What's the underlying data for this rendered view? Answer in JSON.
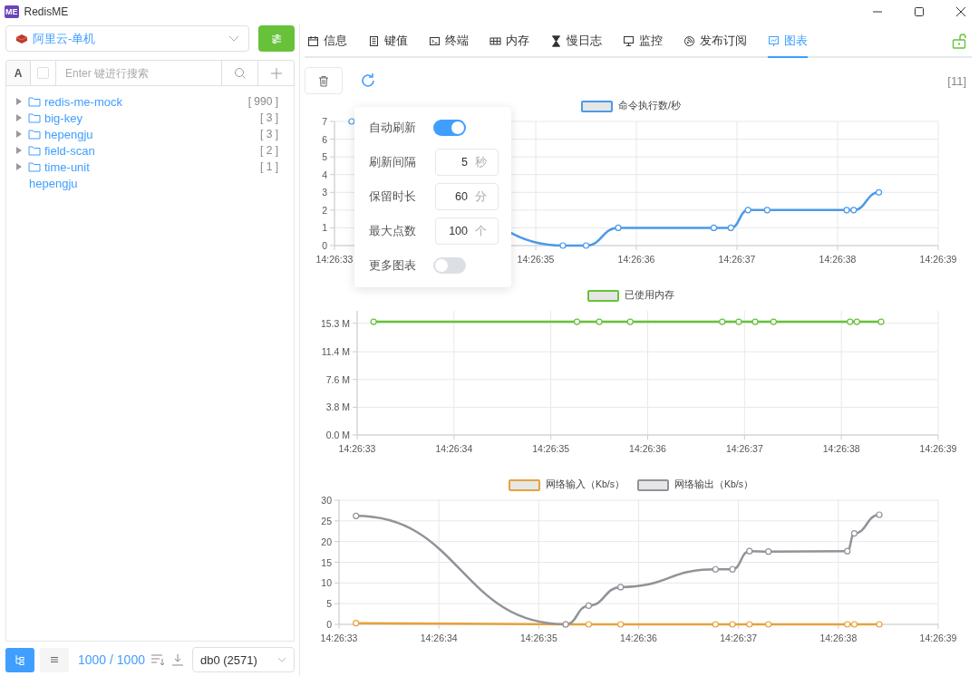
{
  "window": {
    "app_icon": "ME",
    "title": "RedisME"
  },
  "connection": {
    "value": "阿里云-单机"
  },
  "search": {
    "case_toggle": "A",
    "checked": false,
    "placeholder": "Enter 键进行搜索"
  },
  "tree": [
    {
      "kind": "folder",
      "name": "redis-me-mock",
      "count": "[ 990 ]",
      "expanded": false
    },
    {
      "kind": "folder",
      "name": "big-key",
      "count": "[ 3 ]",
      "expanded": false
    },
    {
      "kind": "folder",
      "name": "hepengju",
      "count": "[ 3 ]",
      "expanded": false
    },
    {
      "kind": "folder",
      "name": "field-scan",
      "count": "[ 2 ]",
      "expanded": false
    },
    {
      "kind": "folder",
      "name": "time-unit",
      "count": "[ 1 ]",
      "expanded": false
    },
    {
      "kind": "key",
      "name": "hepengju"
    }
  ],
  "footer": {
    "views": [
      {
        "selected": true
      },
      {
        "selected": false
      }
    ],
    "count": "1000 / 1000",
    "db": "db0 (2571)"
  },
  "tabs": [
    {
      "label": "信息",
      "selected": false
    },
    {
      "label": "键值",
      "selected": false
    },
    {
      "label": "终端",
      "selected": false
    },
    {
      "label": "内存",
      "selected": false
    },
    {
      "label": "慢日志",
      "selected": false
    },
    {
      "label": "监控",
      "selected": false
    },
    {
      "label": "发布订阅",
      "selected": false
    },
    {
      "label": "图表",
      "selected": true
    }
  ],
  "toolbar": {
    "count": "[11]"
  },
  "settings": [
    {
      "kind": "switch",
      "label": "自动刷新",
      "on": true
    },
    {
      "kind": "number",
      "label": "刷新间隔",
      "value": "5",
      "unit": "秒"
    },
    {
      "kind": "number",
      "label": "保留时长",
      "value": "60",
      "unit": "分"
    },
    {
      "kind": "number",
      "label": "最大点数",
      "value": "100",
      "unit": "个"
    },
    {
      "kind": "switch",
      "label": "更多图表",
      "on": false
    }
  ],
  "charts": [
    {
      "chart_data": {
        "type": "line",
        "x": [
          51993.17,
          51995.27,
          51995.5,
          51995.82,
          51996.77,
          51996.94,
          51997.11,
          51997.3,
          51998.09,
          51998.16,
          51998.41
        ],
        "series": [
          {
            "name": "命令执行数/秒",
            "color": "#4a9ae8",
            "marker": "circle",
            "values": [
              7,
              0,
              0,
              1,
              1,
              1,
              2,
              2,
              2,
              2,
              3
            ]
          }
        ],
        "xlim": [
          51993,
          51999
        ],
        "grid": true,
        "legend": "top",
        "ylim": [
          0,
          7
        ],
        "xticks": [
          {
            "value": 51993,
            "label": "14:26:33"
          },
          {
            "value": 51995,
            "label": "14:26:35"
          },
          {
            "value": 51996,
            "label": "14:26:36"
          },
          {
            "value": 51997,
            "label": "14:26:37"
          },
          {
            "value": 51998,
            "label": "14:26:38"
          },
          {
            "value": 51999,
            "label": "14:26:39"
          }
        ],
        "yticks": [
          0,
          1,
          2,
          3,
          4,
          5,
          6,
          7
        ]
      }
    },
    {
      "chart_data": {
        "type": "line",
        "x": [
          51993.17,
          51995.27,
          51995.5,
          51995.82,
          51996.77,
          51996.94,
          51997.11,
          51997.3,
          51998.09,
          51998.16,
          51998.41
        ],
        "series": [
          {
            "name": "已使用内存",
            "color": "#67c23a",
            "marker": "circle",
            "values": [
              15.5,
              15.5,
              15.5,
              15.5,
              15.5,
              15.5,
              15.5,
              15.5,
              15.5,
              15.5,
              15.5
            ]
          }
        ],
        "xlim": [
          51993,
          51999
        ],
        "grid": true,
        "legend": "top",
        "ylim": [
          0,
          17
        ],
        "xticks": [
          {
            "value": 51993,
            "label": "14:26:33"
          },
          {
            "value": 51994,
            "label": "14:26:34"
          },
          {
            "value": 51995,
            "label": "14:26:35"
          },
          {
            "value": 51996,
            "label": "14:26:36"
          },
          {
            "value": 51997,
            "label": "14:26:37"
          },
          {
            "value": 51998,
            "label": "14:26:38"
          },
          {
            "value": 51999,
            "label": "14:26:39"
          }
        ],
        "yticks": [
          {
            "value": 0,
            "label": "0.0 M"
          },
          {
            "value": 3.8,
            "label": "3.8 M"
          },
          {
            "value": 7.6,
            "label": "7.6 M"
          },
          {
            "value": 11.4,
            "label": "11.4 M"
          },
          {
            "value": 15.3,
            "label": "15.3 M"
          }
        ]
      }
    },
    {
      "chart_data": {
        "type": "line",
        "x": [
          51993.17,
          51995.27,
          51995.5,
          51995.82,
          51996.77,
          51996.94,
          51997.11,
          51997.3,
          51998.09,
          51998.16,
          51998.41
        ],
        "series": [
          {
            "name": "网络输入（Kb/s）",
            "color": "#e6a23c",
            "marker": "circle",
            "values": [
              0.3,
              0,
              0,
              0,
              0,
              0,
              0,
              0,
              0,
              0,
              0
            ]
          },
          {
            "name": "网络输出（Kb/s）",
            "color": "#909399",
            "marker": "circle",
            "values": [
              26.2,
              0,
              4.5,
              9,
              13.3,
              13.3,
              17.7,
              17.6,
              17.7,
              22,
              26.5
            ]
          }
        ],
        "xlim": [
          51993,
          51999
        ],
        "grid": true,
        "legend": "top",
        "ylim": [
          0,
          30
        ],
        "xticks": [
          {
            "value": 51993,
            "label": "14:26:33"
          },
          {
            "value": 51994,
            "label": "14:26:34"
          },
          {
            "value": 51995,
            "label": "14:26:35"
          },
          {
            "value": 51996,
            "label": "14:26:36"
          },
          {
            "value": 51997,
            "label": "14:26:37"
          },
          {
            "value": 51998,
            "label": "14:26:38"
          },
          {
            "value": 51999,
            "label": "14:26:39"
          }
        ],
        "yticks": [
          0,
          5,
          10,
          15,
          20,
          25,
          30
        ]
      }
    }
  ]
}
